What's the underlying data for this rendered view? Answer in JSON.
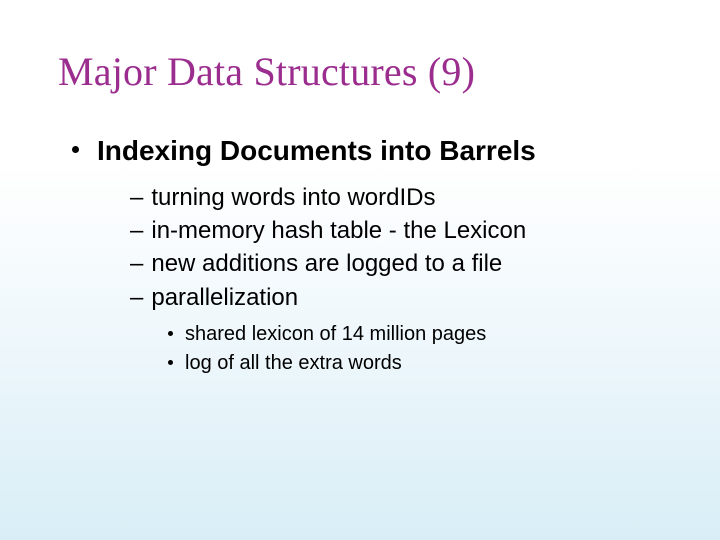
{
  "title": "Major Data Structures (9)",
  "bullets": {
    "l1": "Indexing Documents into Barrels",
    "l2": [
      "turning words into wordIDs",
      "in-memory hash table - the Lexicon",
      "new additions are logged to a file",
      "parallelization"
    ],
    "l3": [
      "shared lexicon of 14 million pages",
      "log of all the extra words"
    ]
  }
}
